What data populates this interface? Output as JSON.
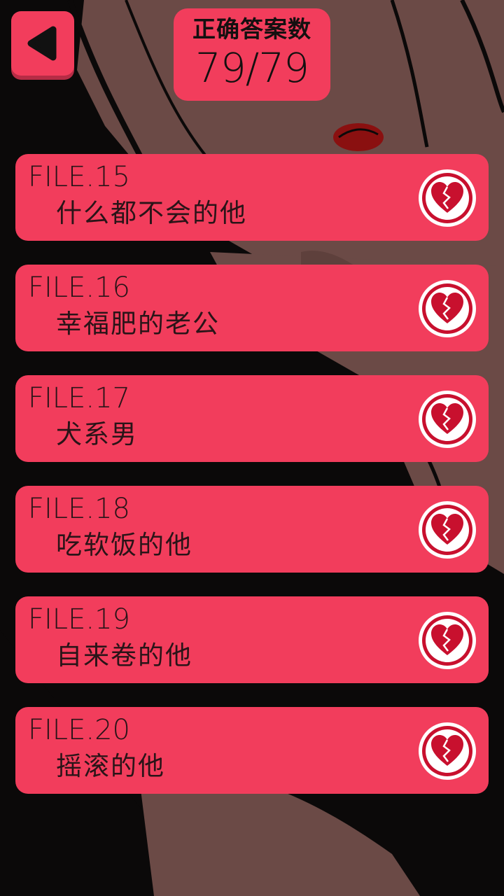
{
  "header": {
    "back_icon": "back-arrow-icon",
    "score_label": "正确答案数",
    "score_value": "79/79"
  },
  "files": [
    {
      "number": "FILE.15",
      "title": "什么都不会的他",
      "status_icon": "broken-heart-icon"
    },
    {
      "number": "FILE.16",
      "title": "幸福肥的老公",
      "status_icon": "broken-heart-icon"
    },
    {
      "number": "FILE.17",
      "title": "犬系男",
      "status_icon": "broken-heart-icon"
    },
    {
      "number": "FILE.18",
      "title": "吃软饭的他",
      "status_icon": "broken-heart-icon"
    },
    {
      "number": "FILE.19",
      "title": "自来卷的他",
      "status_icon": "broken-heart-icon"
    },
    {
      "number": "FILE.20",
      "title": "摇滚的他",
      "status_icon": "broken-heart-icon"
    }
  ],
  "colors": {
    "accent": "#f23d5c",
    "icon_red": "#c8102e",
    "text_dark": "#2a1418",
    "background_dark": "#0b0909",
    "skin_tone": "#6b4a46"
  }
}
